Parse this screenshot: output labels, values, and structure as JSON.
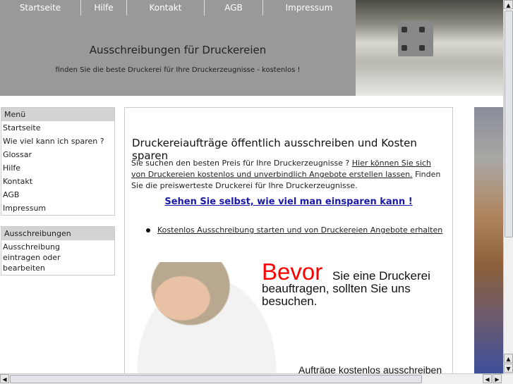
{
  "nav": [
    "Startseite",
    "Hilfe",
    "Kontakt",
    "AGB",
    "Impressum"
  ],
  "header": {
    "title": "Ausschreibungen für Druckereien",
    "subtitle": "finden Sie die beste Druckerei für Ihre Druckerzeugnisse - kostenlos !"
  },
  "menu": {
    "title": "Menü",
    "items": [
      "Startseite",
      "Wie viel kann ich sparen ?",
      "Glossar",
      "Hilfe",
      "Kontakt",
      "AGB",
      "Impressum"
    ]
  },
  "tenders": {
    "title": "Ausschreibungen",
    "item": "Ausschreibung eintragen oder bearbeiten"
  },
  "main": {
    "title": "Druckereiaufträge öffentlich ausschreiben und Kosten sparen",
    "intro_text": "Sie suchen den besten Preis für Ihre Druckerzeugnisse ? ",
    "intro_link": "Hier können Sie sich von Druckereien kostenlos und unverbindlich Angebote erstellen lassen.",
    "intro_rest": " Finden Sie die preiswerteste Druckerei für Ihre Druckerzeugnisse.",
    "cta": "Sehen Sie selbst, wie viel man einsparen kann !",
    "bullet": "Kostenlos Ausschreibung starten und von Druckereien Angebote erhalten"
  },
  "banner": {
    "bevor": "Bevor",
    "text": "Sie eine Druckerei beauftragen, sollten Sie uns besuchen.",
    "footer": "Aufträge kostenlos ausschreiben"
  }
}
